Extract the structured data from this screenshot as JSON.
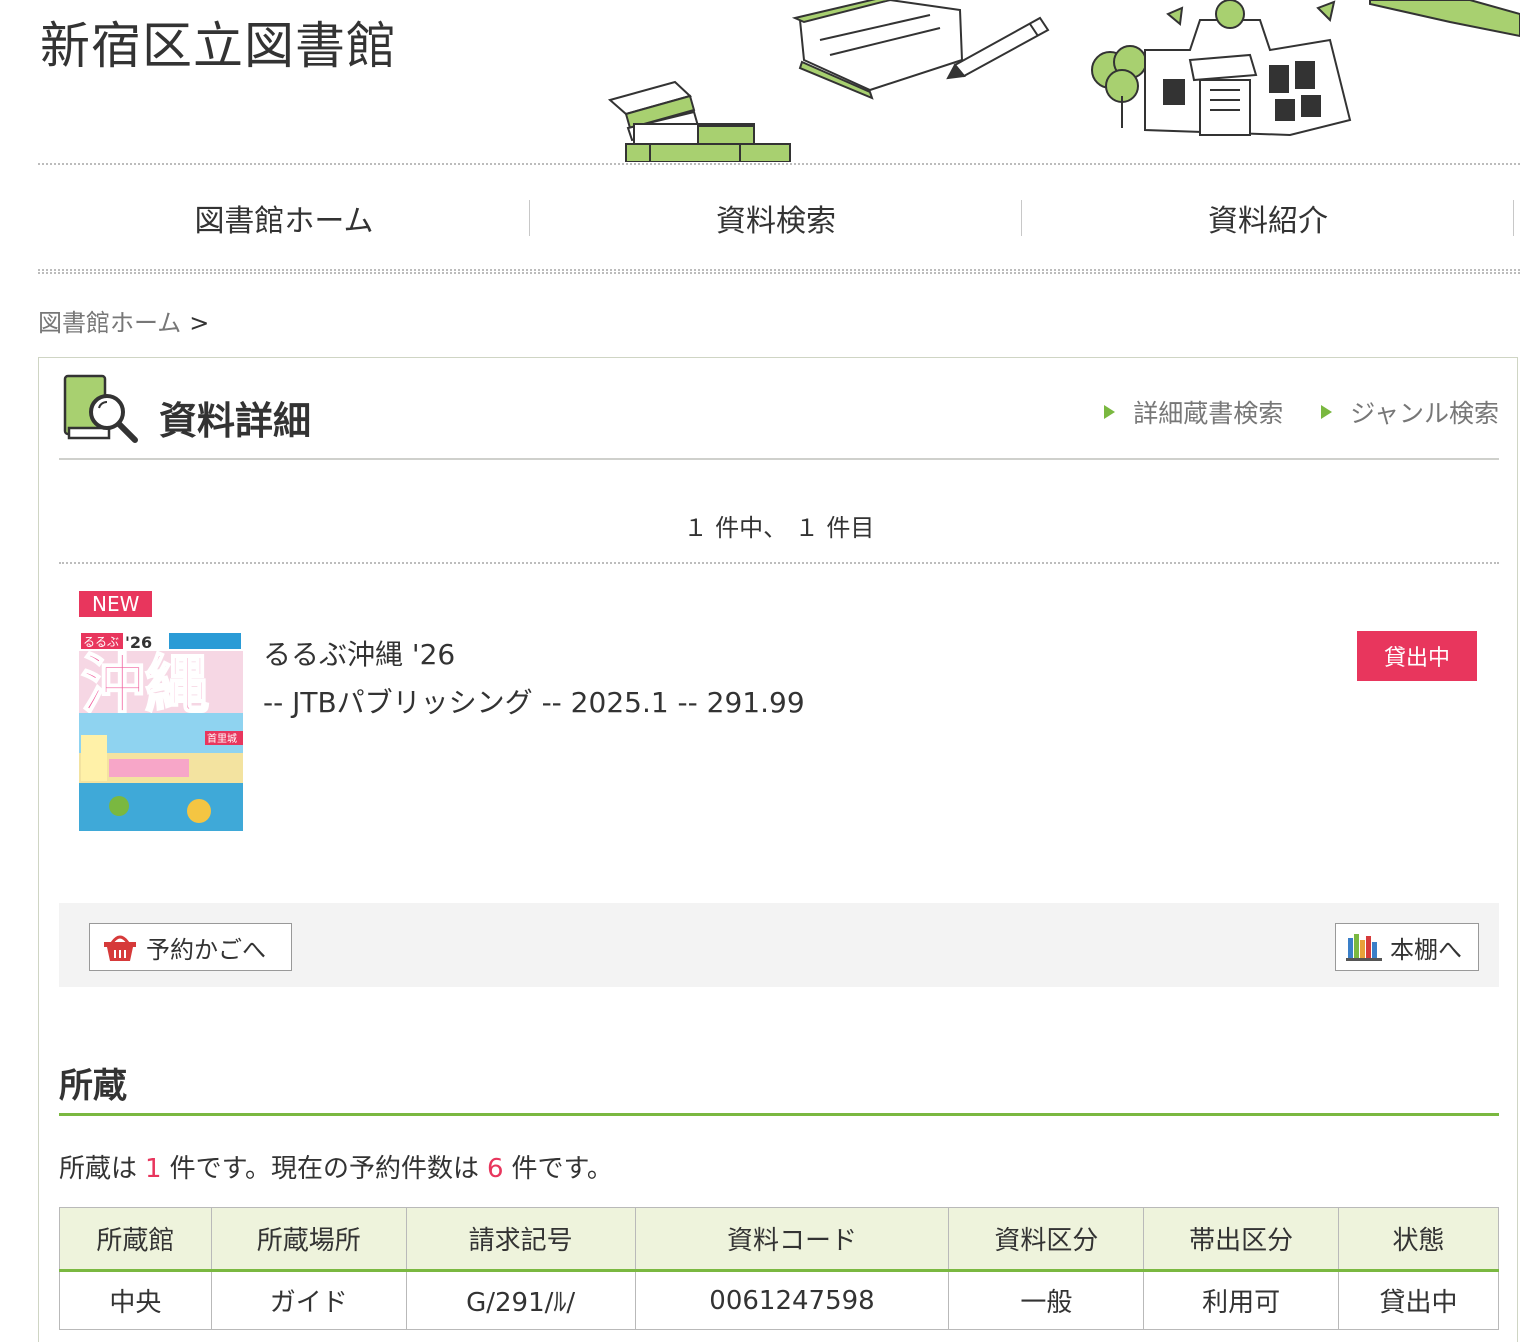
{
  "site": {
    "title": "新宿区立図書館"
  },
  "nav": [
    {
      "label": "図書館ホーム"
    },
    {
      "label": "資料検索"
    },
    {
      "label": "資料紹介"
    }
  ],
  "breadcrumb": {
    "home": "図書館ホーム",
    "separator": ">"
  },
  "panel": {
    "title": "資料詳細",
    "links": [
      {
        "label": "詳細蔵書検索"
      },
      {
        "label": "ジャンル検索"
      }
    ],
    "count_text": "１ 件中、 １ 件目"
  },
  "item": {
    "new_badge": "NEW",
    "cover_text": {
      "series": "るるぶ",
      "year": "'26",
      "main": "沖縄",
      "tag": "首里城"
    },
    "title": "るるぶ沖縄 '26",
    "meta": "-- JTBパブリッシング -- 2025.1 -- 291.99",
    "status": "貸出中"
  },
  "actions": {
    "cart_label": "予約かごへ",
    "shelf_label": "本棚へ"
  },
  "holdings": {
    "section_title": "所蔵",
    "summary": {
      "prefix": "所蔵は",
      "count": "1",
      "middle": "件です。現在の予約件数は",
      "reservations": "6",
      "suffix": "件です。"
    },
    "columns": [
      "所蔵館",
      "所蔵場所",
      "請求記号",
      "資料コード",
      "資料区分",
      "帯出区分",
      "状態"
    ],
    "rows": [
      [
        "中央",
        "ガイド",
        "G/291/ﾙ/",
        "0061247598",
        "一般",
        "利用可",
        "貸出中"
      ]
    ]
  },
  "colors": {
    "accent_green": "#7ab840",
    "status_red": "#e8365d",
    "table_header_bg": "#eef3dc"
  }
}
